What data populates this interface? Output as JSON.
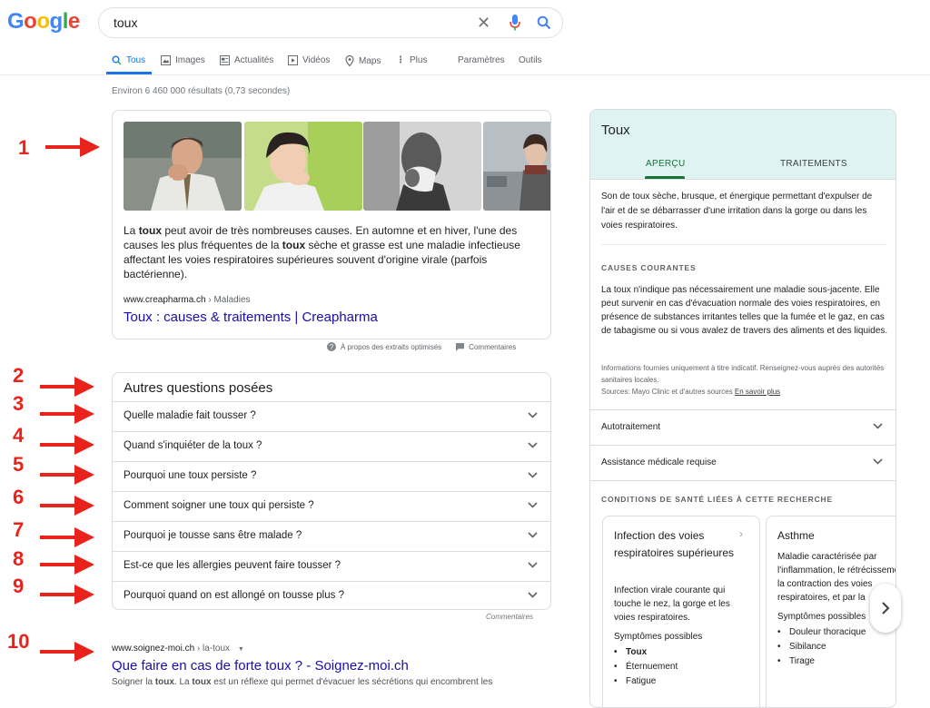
{
  "header": {
    "logo_letters": [
      {
        "ch": "G",
        "color": "#4285f4"
      },
      {
        "ch": "o",
        "color": "#ea4335"
      },
      {
        "ch": "o",
        "color": "#fbbc05"
      },
      {
        "ch": "g",
        "color": "#4285f4"
      },
      {
        "ch": "l",
        "color": "#34a853"
      },
      {
        "ch": "e",
        "color": "#ea4335"
      }
    ],
    "search_query": "toux"
  },
  "tabs": {
    "tous": "Tous",
    "images": "Images",
    "actualites": "Actualités",
    "videos": "Vidéos",
    "maps": "Maps",
    "plus": "Plus",
    "parametres": "Paramètres",
    "outils": "Outils"
  },
  "result_stats": "Environ 6 460 000 résultats (0,73 secondes)",
  "featured_snippet": {
    "text_parts": [
      "La ",
      "toux",
      " peut avoir de très nombreuses causes. En automne et en hiver, l'une des causes les plus fréquentes de la ",
      "toux",
      " sèche et grasse est une maladie infectieuse affectant les voies respiratoires supérieures souvent d'origine virale (parfois bactérienne)."
    ],
    "cite_domain": "www.creapharma.ch",
    "cite_path": " › Maladies",
    "link_title": "Toux : causes & traitements | Creapharma",
    "footer_about": "À propos des extraits optimisés",
    "footer_feedback": "Commentaires"
  },
  "paa": {
    "title": "Autres questions posées",
    "questions": [
      "Quelle maladie fait tousser ?",
      "Quand s'inquiéter de la toux ?",
      "Pourquoi une toux persiste ?",
      "Comment soigner une toux qui persiste ?",
      "Pourquoi je tousse sans être malade ?",
      "Est-ce que les allergies peuvent faire tousser ?",
      "Pourquoi quand on est allongé on tousse plus ?"
    ],
    "feedback": "Commentaires"
  },
  "organic": {
    "cite_domain": "www.soignez-moi.ch",
    "cite_path": " › la-toux",
    "title": "Que faire en cas de forte toux ? - Soignez-moi.ch",
    "snippet_parts": [
      "Soigner la ",
      "toux",
      ". La ",
      "toux",
      " est un réflexe qui permet d'évacuer les sécrétions qui encombrent les"
    ]
  },
  "annotations": [
    "1",
    "2",
    "3",
    "4",
    "5",
    "6",
    "7",
    "8",
    "9",
    "10"
  ],
  "knowledge_panel": {
    "title": "Toux",
    "tab_apercu": "APERÇU",
    "tab_traitements": "TRAITEMENTS",
    "description": "Son de toux sèche, brusque, et énergique permettant d'expulser de l'air et de se débarrasser d'une irritation dans la gorge ou dans les voies respiratoires.",
    "causes_heading": "CAUSES COURANTES",
    "causes_text": "La toux n'indique pas nécessairement une maladie sous-jacente. Elle peut survenir en cas d'évacuation normale des voies respiratoires, en présence de substances irritantes telles que la fumée et le gaz, en cas de tabagisme ou si vous avalez de travers des aliments et des liquides.",
    "info_text": "Informations fournies uniquement à titre indicatif. Renseignez-vous auprès des autorités sanitaires locales.",
    "sources_text": "Sources: Mayo Clinic et d'autres sources ",
    "sources_link": "En savoir plus",
    "row_autotraitement": "Autotraitement",
    "row_assistance": "Assistance médicale requise",
    "conditions_heading": "CONDITIONS DE SANTÉ LIÉES À CETTE RECHERCHE",
    "conditions": [
      {
        "title": "Infection des voies respiratoires supérieures",
        "desc": "Infection virale courante qui touche le nez, la gorge et les voies respiratoires.",
        "symptoms_label": "Symptômes possibles",
        "symptoms": [
          "Toux",
          "Éternuement",
          "Fatigue"
        ]
      },
      {
        "title": "Asthme",
        "desc": "Maladie caractérisée par l'inflammation, le rétrécissement et la contraction des voies respiratoires, et par la",
        "symptoms_label": "Symptômes possibles",
        "symptoms": [
          "Douleur thoracique",
          "Sibilance",
          "Tirage"
        ]
      }
    ]
  }
}
